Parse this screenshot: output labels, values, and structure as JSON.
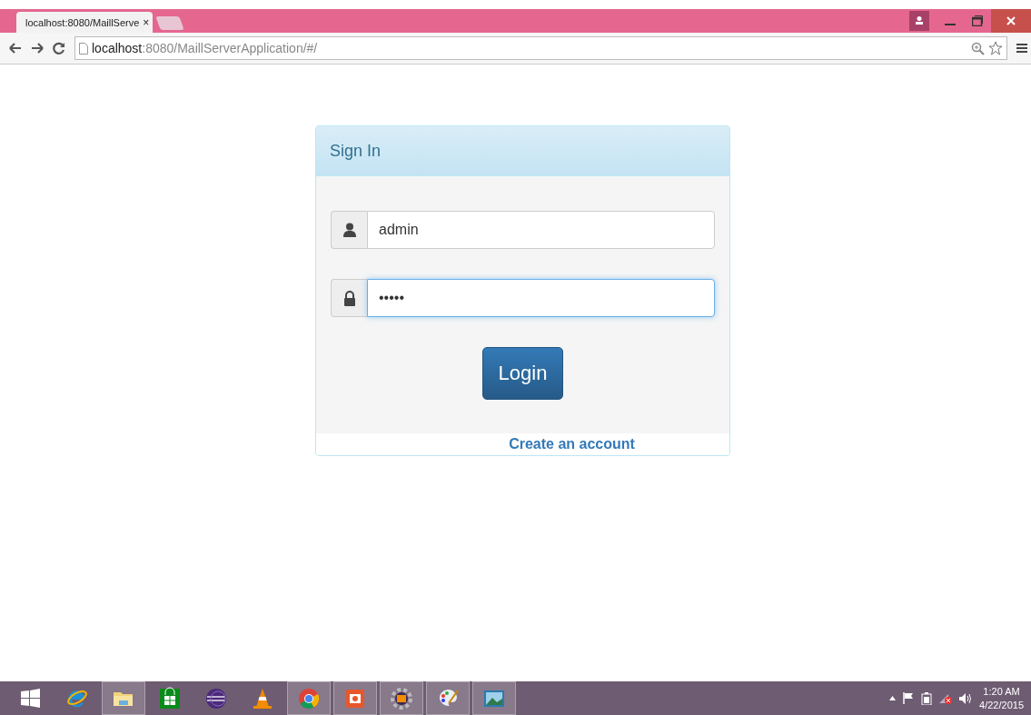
{
  "browser": {
    "tab": {
      "title": "localhost:8080/MaillServe",
      "close": "×",
      "selected": true
    },
    "address": {
      "host": "localhost",
      "path": ":8080/MaillServerApplication/#/"
    }
  },
  "panel": {
    "title": "Sign In",
    "fields": [
      {
        "kind": "user",
        "value": "admin",
        "focused": false
      },
      {
        "kind": "lock",
        "value": "•••••",
        "focused": true
      }
    ],
    "button": "Login",
    "link": "Create an account"
  },
  "taskbar": {
    "apps": [
      {
        "kind": "start",
        "active": false
      },
      {
        "kind": "ie",
        "active": false
      },
      {
        "kind": "folder",
        "active": true
      },
      {
        "kind": "store",
        "active": false
      },
      {
        "kind": "eclipse",
        "active": false
      },
      {
        "kind": "cone",
        "active": false
      },
      {
        "kind": "chrome",
        "active": true
      },
      {
        "kind": "slides",
        "active": true
      },
      {
        "kind": "gear",
        "active": true
      },
      {
        "kind": "palette",
        "active": true
      },
      {
        "kind": "photo",
        "active": true
      }
    ],
    "time": "1:20 AM",
    "date": "4/22/2015"
  }
}
